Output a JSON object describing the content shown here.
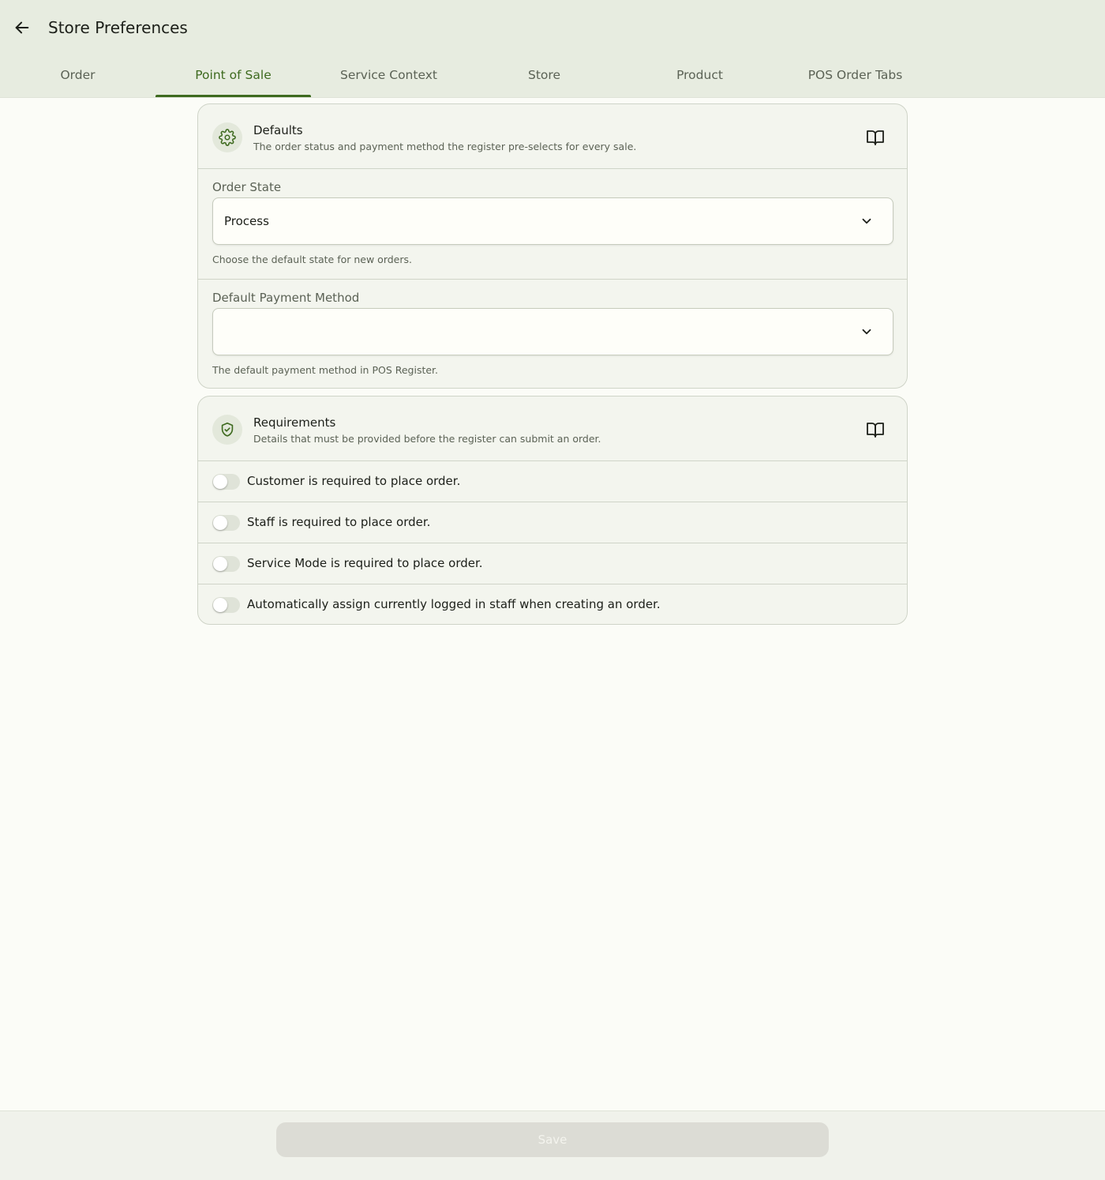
{
  "header": {
    "title": "Store Preferences",
    "back_icon": "arrow-left-icon"
  },
  "tabs": [
    {
      "label": "Order",
      "active": false
    },
    {
      "label": "Point of Sale",
      "active": true
    },
    {
      "label": "Service Context",
      "active": false
    },
    {
      "label": "Store",
      "active": false
    },
    {
      "label": "Product",
      "active": false
    },
    {
      "label": "POS Order Tabs",
      "active": false
    }
  ],
  "defaults_card": {
    "icon": "gear-icon",
    "title": "Defaults",
    "subtitle": "The order status and payment method the register pre-selects for every sale.",
    "fields": {
      "order_state": {
        "label": "Order State",
        "value": "Process",
        "help": "Choose the default state for new orders."
      },
      "payment_method": {
        "label": "Default Payment Method",
        "value": "",
        "help": "The default payment method in POS Register."
      }
    }
  },
  "requirements_card": {
    "icon": "shield-check-icon",
    "title": "Requirements",
    "subtitle": "Details that must be provided before the register can submit an order.",
    "toggles": [
      {
        "label": "Customer is required to place order.",
        "on": false
      },
      {
        "label": "Staff is required to place order.",
        "on": false
      },
      {
        "label": "Service Mode is required to place order.",
        "on": false
      },
      {
        "label": "Automatically assign currently logged in staff when creating an order.",
        "on": false
      }
    ]
  },
  "footer": {
    "save_label": "Save",
    "save_disabled": true
  },
  "colors": {
    "accent": "#3e6a1f",
    "appbar_bg": "#e7ece0",
    "page_bg": "#fbfcf7",
    "card_bg": "#f3f5ee"
  }
}
